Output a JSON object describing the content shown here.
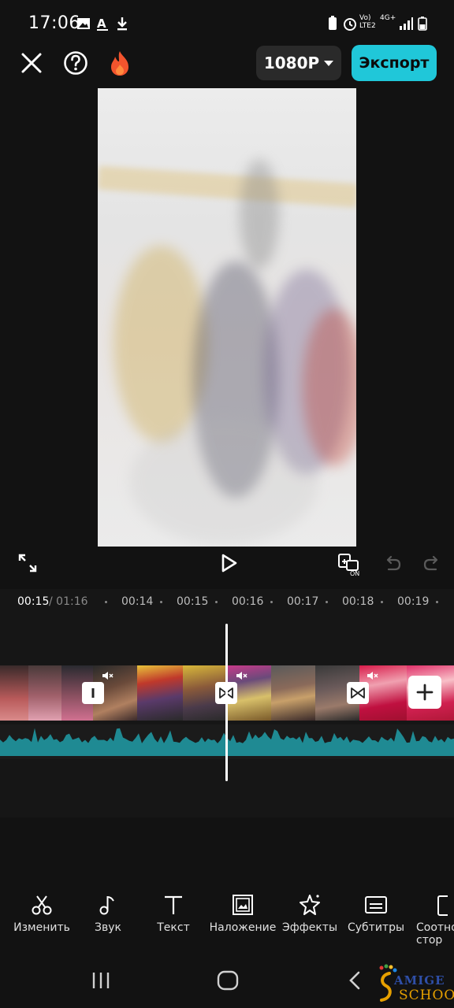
{
  "status_bar": {
    "time": "17:06",
    "network_line1": "Vo)",
    "network_line2": "LTE2",
    "network_type": "4G+"
  },
  "top_bar": {
    "resolution": "1080P",
    "export_label": "Экспорт",
    "accent_color": "#20c7d9"
  },
  "timeline": {
    "current_time": "00:15",
    "total_time": "/ 01:16",
    "ticks": [
      "00:14",
      "00:15",
      "00:16",
      "00:17",
      "00:18",
      "00:19"
    ]
  },
  "tools": [
    {
      "label": "Изменить",
      "icon": "scissors-icon"
    },
    {
      "label": "Звук",
      "icon": "music-note-icon"
    },
    {
      "label": "Текст",
      "icon": "text-icon"
    },
    {
      "label": "Наложение",
      "icon": "overlay-icon"
    },
    {
      "label": "Эффекты",
      "icon": "star-icon"
    },
    {
      "label": "Субтитры",
      "icon": "subtitles-icon"
    },
    {
      "label": "Соотно стор",
      "icon": "aspect-ratio-icon"
    }
  ],
  "watermark": {
    "brand_main": "AMIGE",
    "brand_sub": "SCHOOL"
  }
}
